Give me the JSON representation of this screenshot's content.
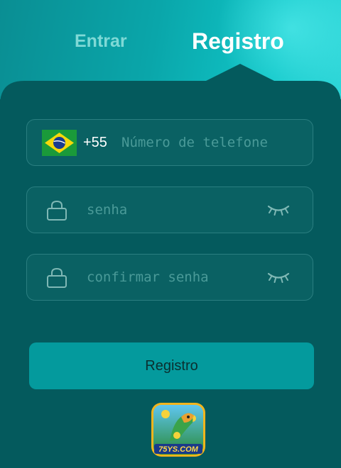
{
  "tabs": {
    "login_label": "Entrar",
    "register_label": "Registro",
    "active": "Registro"
  },
  "phone": {
    "country_code": "+55",
    "country_flag": "brazil-flag-icon",
    "placeholder": "Número de telefone",
    "value": ""
  },
  "password": {
    "placeholder": "senha",
    "value": ""
  },
  "confirm_password": {
    "placeholder": "confirmar senha",
    "value": ""
  },
  "submit": {
    "label": "Registro"
  },
  "logo": {
    "text": "75YS.COM"
  },
  "colors": {
    "panel": "#045a5d",
    "header_gradient_start": "#0a8e93",
    "header_gradient_end": "#2ed6d8",
    "field_bg": "#0a6163",
    "field_border": "#2a7e80",
    "button_bg": "#049a9d",
    "placeholder": "#4a9a98"
  }
}
